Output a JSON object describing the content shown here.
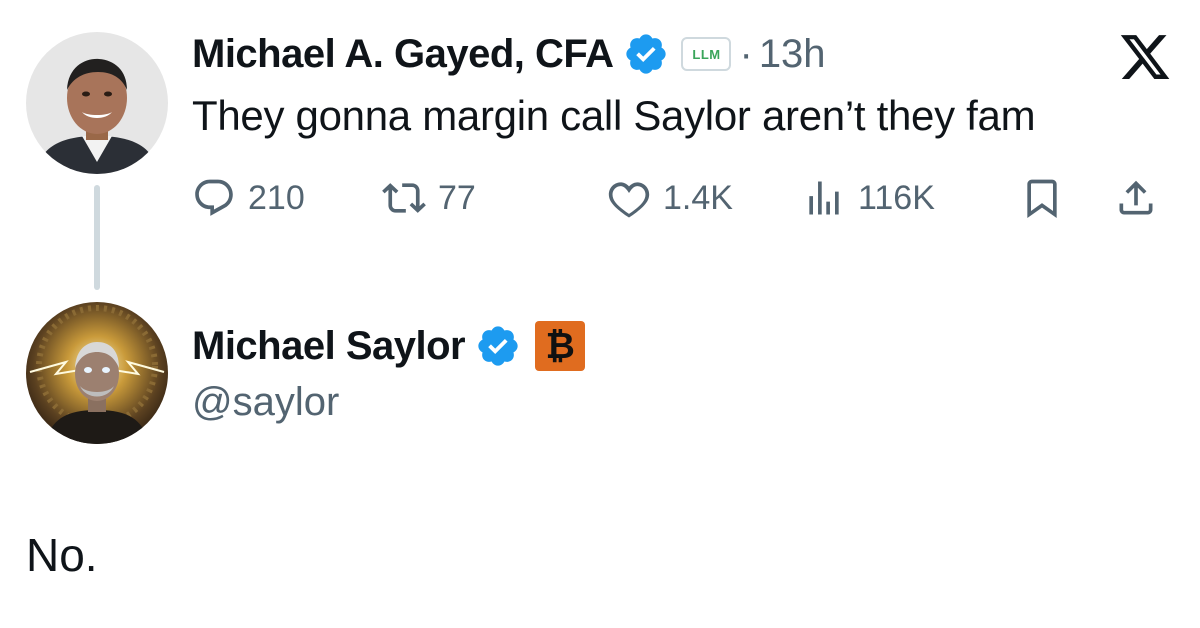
{
  "reply": {
    "author": {
      "display_name": "Michael A. Gayed, CFA",
      "verified": true,
      "affiliate_badge": "LLM",
      "separator": "·",
      "timestamp": "13h"
    },
    "text": "They gonna margin call Saylor aren’t they fam",
    "actions": {
      "replies": "210",
      "reposts": "77",
      "likes": "1.4K",
      "views": "116K"
    }
  },
  "original": {
    "author": {
      "display_name": "Michael Saylor",
      "verified": true,
      "badge": "₿",
      "handle": "@saylor"
    },
    "text": "No."
  },
  "icons": {
    "verified": "verified-checkmark-icon",
    "x_logo": "x-logo-icon",
    "reply": "reply-bubble-icon",
    "repost": "repost-arrows-icon",
    "like": "heart-icon",
    "views": "views-bars-icon",
    "bookmark": "bookmark-icon",
    "share": "share-upload-icon"
  },
  "colors": {
    "text_primary": "#0f1419",
    "text_secondary": "#536471",
    "verified_blue": "#1d9bf0",
    "thread_line": "#cfd9de",
    "bitcoin_orange": "#e06c1f"
  }
}
